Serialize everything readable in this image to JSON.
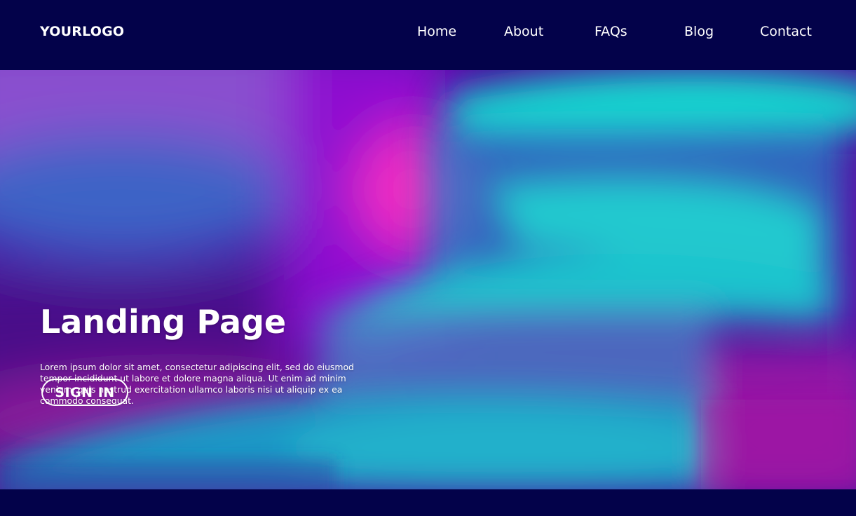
{
  "header": {
    "logo": "YOURLOGO",
    "nav": [
      "Home",
      "About",
      "FAQs",
      "Blog",
      "Contact"
    ]
  },
  "hero": {
    "title": "Landing Page",
    "body": "Lorem ipsum dolor sit amet, consectetur adipiscing elit, sed do eiusmod tempor incididunt ut labore et dolore magna aliqua. Ut enim ad minim veniam, quis nostrud exercitation ullamco laboris nisi ut aliquip ex ea commodo consequat.",
    "cta": "SIGN IN"
  },
  "colors": {
    "navy": "#03024a",
    "purple": "#6b10c9",
    "magenta": "#e42bbf",
    "teal": "#11d6c9",
    "blue": "#3f6fc5",
    "text": "#ffffff"
  }
}
